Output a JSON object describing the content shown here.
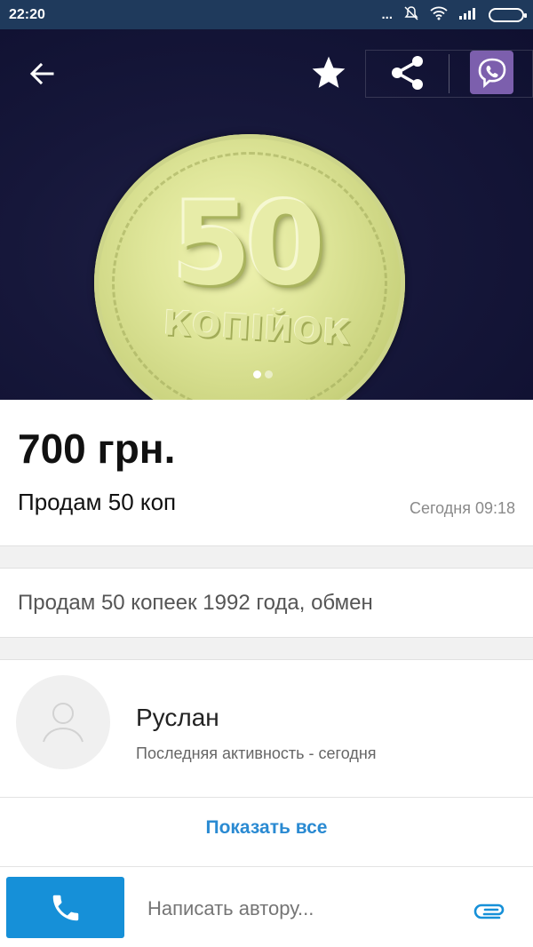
{
  "status_bar": {
    "time": "22:20",
    "dots": "...",
    "icons": [
      "mute-icon",
      "wifi-icon",
      "signal-icon",
      "battery-icon"
    ]
  },
  "toolbar": {
    "back_icon": "back-arrow-icon",
    "favorite_icon": "star-icon",
    "share_icon": "share-icon",
    "viber_icon": "viber-icon"
  },
  "gallery": {
    "image_count": 2,
    "active_index": 0
  },
  "listing": {
    "price": "700 грн.",
    "title": "Продам 50 коп",
    "date": "Сегодня 09:18",
    "description": "Продам 50 копеек 1992 года, обмен"
  },
  "seller": {
    "name": "Руслан",
    "activity": "Последняя активность - сегодня",
    "show_all": "Показать все"
  },
  "bottom_bar": {
    "message_placeholder": "Написать автору...",
    "call_icon": "phone-icon",
    "attach_icon": "paperclip-icon"
  },
  "colors": {
    "accent": "#1690d8",
    "link": "#2a8ad2",
    "status_bar": "#1f3a5c",
    "viber": "#7c5fad"
  }
}
